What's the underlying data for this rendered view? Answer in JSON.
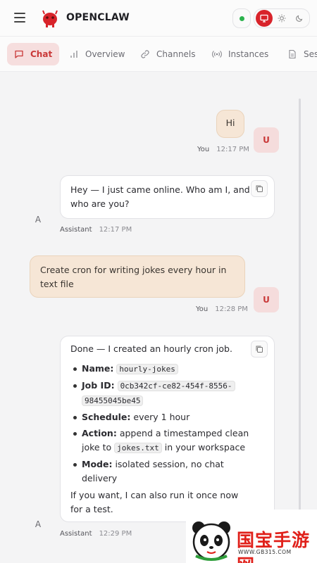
{
  "header": {
    "brand": "OPENCLAW",
    "status_color": "#2bb24c",
    "accent": "#d8232a"
  },
  "tabs": [
    {
      "label": "Chat",
      "icon": "chat-bubble-icon",
      "active": true
    },
    {
      "label": "Overview",
      "icon": "bar-chart-icon"
    },
    {
      "label": "Channels",
      "icon": "link-icon"
    },
    {
      "label": "Instances",
      "icon": "radio-icon"
    },
    {
      "label": "Ses",
      "icon": "document-icon"
    }
  ],
  "messages": [
    {
      "role": "user",
      "text": "Hi",
      "who": "You",
      "time": "12:17 PM",
      "avatar": "U"
    },
    {
      "role": "assistant",
      "text_line1": "Hey — I just came online. Who am I, and",
      "text_line2": "who are you?",
      "who": "Assistant",
      "time": "12:17 PM",
      "avatar": "A"
    },
    {
      "role": "user",
      "text_line1": "Create cron for writing jokes every hour in",
      "text_line2": "text file",
      "who": "You",
      "time": "12:28 PM",
      "avatar": "U"
    },
    {
      "role": "assistant",
      "intro": "Done — I created an hourly cron job.",
      "name_label": "Name:",
      "name_value": "hourly-jokes",
      "jobid_label": "Job ID:",
      "jobid_value_1": "0cb342cf-ce82-454f-8556-",
      "jobid_value_2": "98455045be45",
      "schedule_label": "Schedule:",
      "schedule_value": "every 1 hour",
      "action_label": "Action:",
      "action_value_1": "append a timestamped clean",
      "action_value_2a": "joke to",
      "action_file": "jokes.txt",
      "action_value_2b": "in your workspace",
      "mode_label": "Mode:",
      "mode_value_1": "isolated session, no chat",
      "mode_value_2": "delivery",
      "outro_1": "If you want, I can also run it once now",
      "outro_2": "for a test.",
      "who": "Assistant",
      "time": "12:29 PM",
      "avatar": "A"
    }
  ],
  "watermark": {
    "text": "国宝手游网",
    "url": "WWW.GB315.COM"
  }
}
